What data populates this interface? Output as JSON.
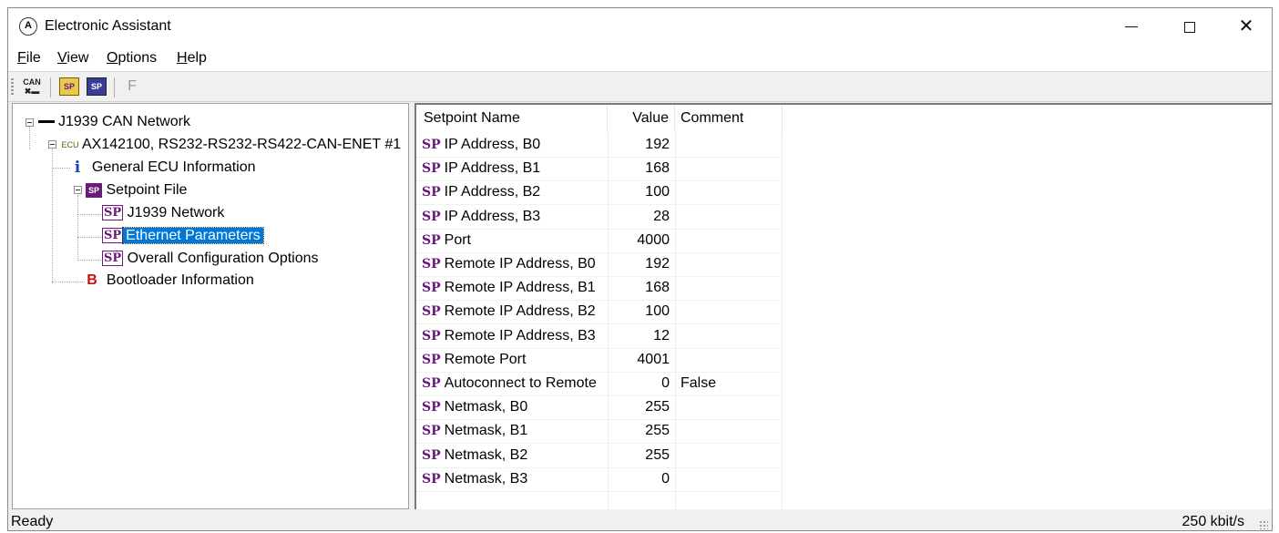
{
  "window": {
    "title": "Electronic Assistant",
    "controls": {
      "minimize": "min",
      "maximize": "max",
      "close": "✕"
    }
  },
  "menu": [
    {
      "label": "File",
      "accel": "F",
      "rest": "ile"
    },
    {
      "label": "View",
      "accel": "V",
      "rest": "iew"
    },
    {
      "label": "Options",
      "accel": "O",
      "rest": "ptions"
    },
    {
      "label": "Help",
      "accel": "H",
      "rest": "elp"
    }
  ],
  "toolbar": {
    "can_icon_label": "CAN",
    "sp_label": "SP",
    "f_label": "F"
  },
  "tree": {
    "network": "J1939 CAN Network",
    "ecu_tag": "ECU",
    "ecu": "AX142100, RS232-RS232-RS422-CAN-ENET #1",
    "info_glyph": "i",
    "general": "General ECU Information",
    "spfile_tag": "SP",
    "setpoint_file": "Setpoint File",
    "sp_tag": "SP",
    "j1939": "J1939 Network",
    "ethernet": "Ethernet Parameters",
    "overall": "Overall Configuration Options",
    "boot_glyph": "B",
    "bootloader": "Bootloader Information"
  },
  "grid": {
    "headers": {
      "name": "Setpoint Name",
      "value": "Value",
      "comment": "Comment"
    },
    "sp_tag": "SP",
    "rows": [
      {
        "name": "IP Address, B0",
        "value": "192",
        "comment": ""
      },
      {
        "name": "IP Address, B1",
        "value": "168",
        "comment": ""
      },
      {
        "name": "IP Address, B2",
        "value": "100",
        "comment": ""
      },
      {
        "name": "IP Address, B3",
        "value": "28",
        "comment": ""
      },
      {
        "name": "Port",
        "value": "4000",
        "comment": ""
      },
      {
        "name": "Remote IP Address, B0",
        "value": "192",
        "comment": ""
      },
      {
        "name": "Remote IP Address, B1",
        "value": "168",
        "comment": ""
      },
      {
        "name": "Remote IP Address, B2",
        "value": "100",
        "comment": ""
      },
      {
        "name": "Remote IP Address, B3",
        "value": "12",
        "comment": ""
      },
      {
        "name": "Remote Port",
        "value": "4001",
        "comment": ""
      },
      {
        "name": "Autoconnect to Remote",
        "value": "0",
        "comment": "False"
      },
      {
        "name": "Netmask, B0",
        "value": "255",
        "comment": ""
      },
      {
        "name": "Netmask, B1",
        "value": "255",
        "comment": ""
      },
      {
        "name": "Netmask, B2",
        "value": "255",
        "comment": ""
      },
      {
        "name": "Netmask, B3",
        "value": "0",
        "comment": ""
      }
    ]
  },
  "status": {
    "left": "Ready",
    "right": "250 kbit/s"
  },
  "colors": {
    "selection": "#0078d7",
    "sp_purple": "#6a1b7a",
    "boot_red": "#d01010",
    "info_blue": "#1f3fbf"
  }
}
